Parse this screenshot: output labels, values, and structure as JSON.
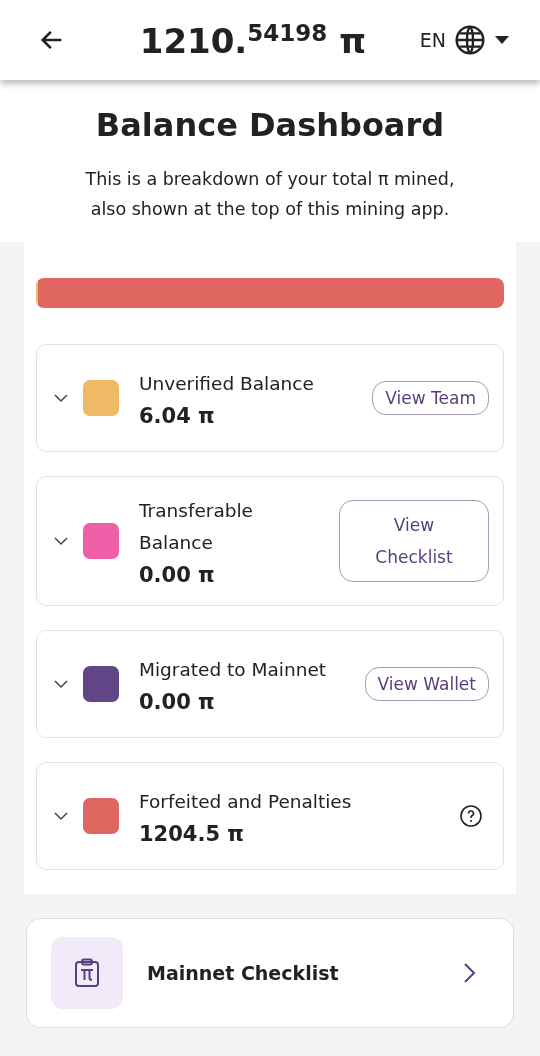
{
  "header": {
    "balance": "1210.$^{54198}$ π",
    "language": "EN"
  },
  "title": "Balance Dashboard",
  "description": "This is a breakdown of your total π mined, also shown at the top of this mining app.",
  "balances": [
    {
      "kind": "button",
      "label": "Unverified Balance",
      "amount": "6.04 π",
      "color": "#f0b965",
      "level": 0.005,
      "expanded": false,
      "action": "View Team"
    },
    {
      "kind": "button",
      "label": "Transferable Balance",
      "amount": "0.00 π",
      "color": "#ee5fa7",
      "level": 0,
      "expanded": false,
      "action": "View Checklist"
    },
    {
      "kind": "button",
      "label": "Migrated to Mainnet",
      "amount": "0.00 π",
      "color": "#624586",
      "level": 0,
      "expanded": false,
      "action": "View Wallet"
    },
    {
      "kind": "help",
      "label": "Forfeited and Penalties",
      "amount": "1204.5 π",
      "color": "#e06661",
      "level": 0.995,
      "expanded": false
    }
  ],
  "checklist_link": {
    "label": "Mainnet Checklist"
  }
}
